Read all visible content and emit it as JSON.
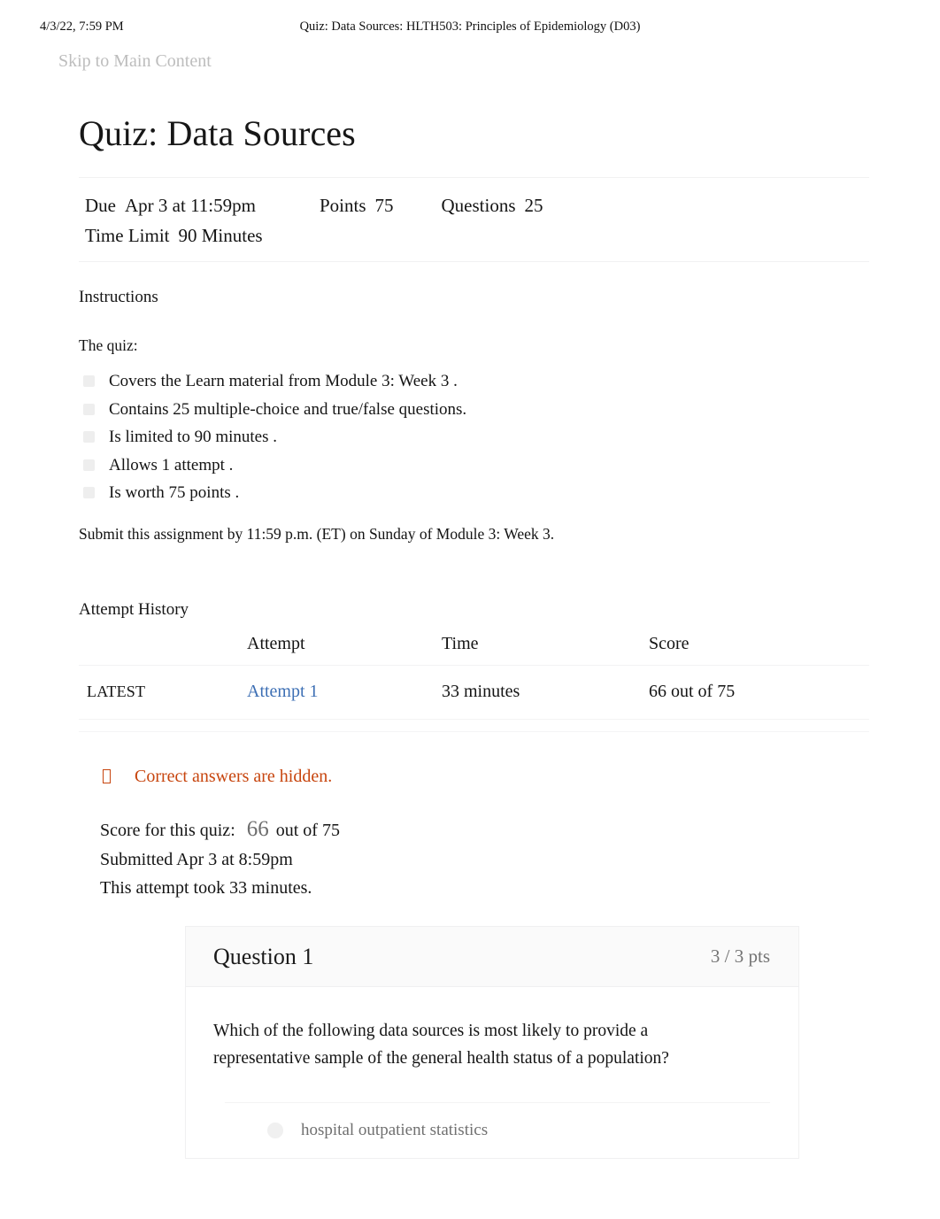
{
  "print_header": {
    "date": "4/3/22, 7:59 PM",
    "doc_title": "Quiz: Data Sources: HLTH503: Principles of Epidemiology (D03)"
  },
  "skip_link": "Skip to Main Content",
  "quiz": {
    "title": "Quiz: Data Sources",
    "meta": {
      "due_label": "Due",
      "due_value": "Apr 3 at 11:59pm",
      "points_label": "Points",
      "points_value": "75",
      "questions_label": "Questions",
      "questions_value": "25",
      "time_limit_label": "Time Limit",
      "time_limit_value": "90 Minutes"
    }
  },
  "instructions": {
    "heading": "Instructions",
    "lead": "The quiz:",
    "bullets": [
      "Covers the   Learn  material from   Module 3: Week 3   .",
      "Contains   25 multiple-choice    and  true/false   questions.",
      "Is limited  to  90  minutes  .",
      "Allows  1 attempt   .",
      "Is worth 75 points   ."
    ],
    "submit_note": "Submit this assignment by 11:59 p.m. (ET) on Sunday of Module 3: Week 3."
  },
  "attempt_history": {
    "heading": "Attempt History",
    "columns": [
      "",
      "Attempt",
      "Time",
      "Score"
    ],
    "rows": [
      {
        "kept": "LATEST",
        "attempt": "Attempt 1",
        "time": "33 minutes",
        "score": "66 out of 75"
      }
    ]
  },
  "results": {
    "answers_hidden_notice": "Correct answers are hidden.",
    "answers_hidden_icon": "warning-tofu-icon",
    "score_label": "Score for this quiz:",
    "score_value": "66",
    "score_suffix": "out of 75",
    "submitted_text": "Submitted Apr 3 at 8:59pm",
    "duration_text": "This attempt took 33 minutes."
  },
  "question": {
    "name": "Question 1",
    "points": "3 / 3 pts",
    "text": "Which of the following data sources is most likely to provide a representative sample of the general health status of a population?",
    "answers": [
      {
        "label": "hospital outpatient statistics",
        "selected": false
      }
    ]
  },
  "colors": {
    "link_blue": "#3d6fb4",
    "notice_orange": "#c7450e",
    "muted_gray": "#707070",
    "rule_gray": "#f1f1f2"
  }
}
